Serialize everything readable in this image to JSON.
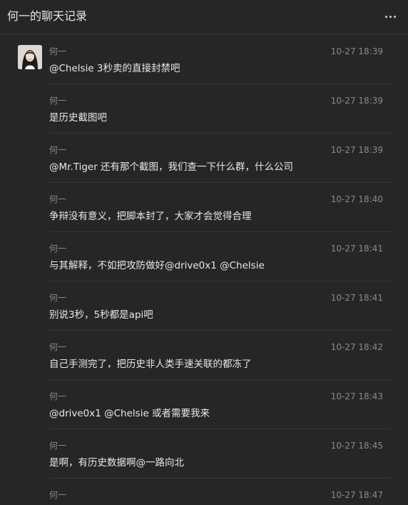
{
  "header": {
    "title": "何一的聊天记录",
    "more_icon": "more-horizontal-icon"
  },
  "messages": [
    {
      "sender": "何一",
      "time": "10-27 18:39",
      "text": "@Chelsie 3秒卖的直接封禁吧",
      "show_avatar": true
    },
    {
      "sender": "何一",
      "time": "10-27 18:39",
      "text": "是历史截图吧",
      "show_avatar": false
    },
    {
      "sender": "何一",
      "time": "10-27 18:39",
      "text": "@Mr.Tiger 还有那个截图，我们查一下什么群，什么公司",
      "show_avatar": false
    },
    {
      "sender": "何一",
      "time": "10-27 18:40",
      "text": "争辩没有意义，把脚本封了，大家才会觉得合理",
      "show_avatar": false
    },
    {
      "sender": "何一",
      "time": "10-27 18:41",
      "text": "与其解释，不如把攻防做好@drive0x1 @Chelsie",
      "show_avatar": false
    },
    {
      "sender": "何一",
      "time": "10-27 18:41",
      "text": "别说3秒，5秒都是api吧",
      "show_avatar": false
    },
    {
      "sender": "何一",
      "time": "10-27 18:42",
      "text": "自己手测完了，把历史非人类手速关联的都冻了",
      "show_avatar": false
    },
    {
      "sender": "何一",
      "time": "10-27 18:43",
      "text": "@drive0x1 @Chelsie 或者需要我来",
      "show_avatar": false
    },
    {
      "sender": "何一",
      "time": "10-27 18:45",
      "text": "是啊，有历史数据啊@一路向北",
      "show_avatar": false
    },
    {
      "sender": "何一",
      "time": "10-27 18:47",
      "text": "",
      "show_avatar": false
    }
  ]
}
